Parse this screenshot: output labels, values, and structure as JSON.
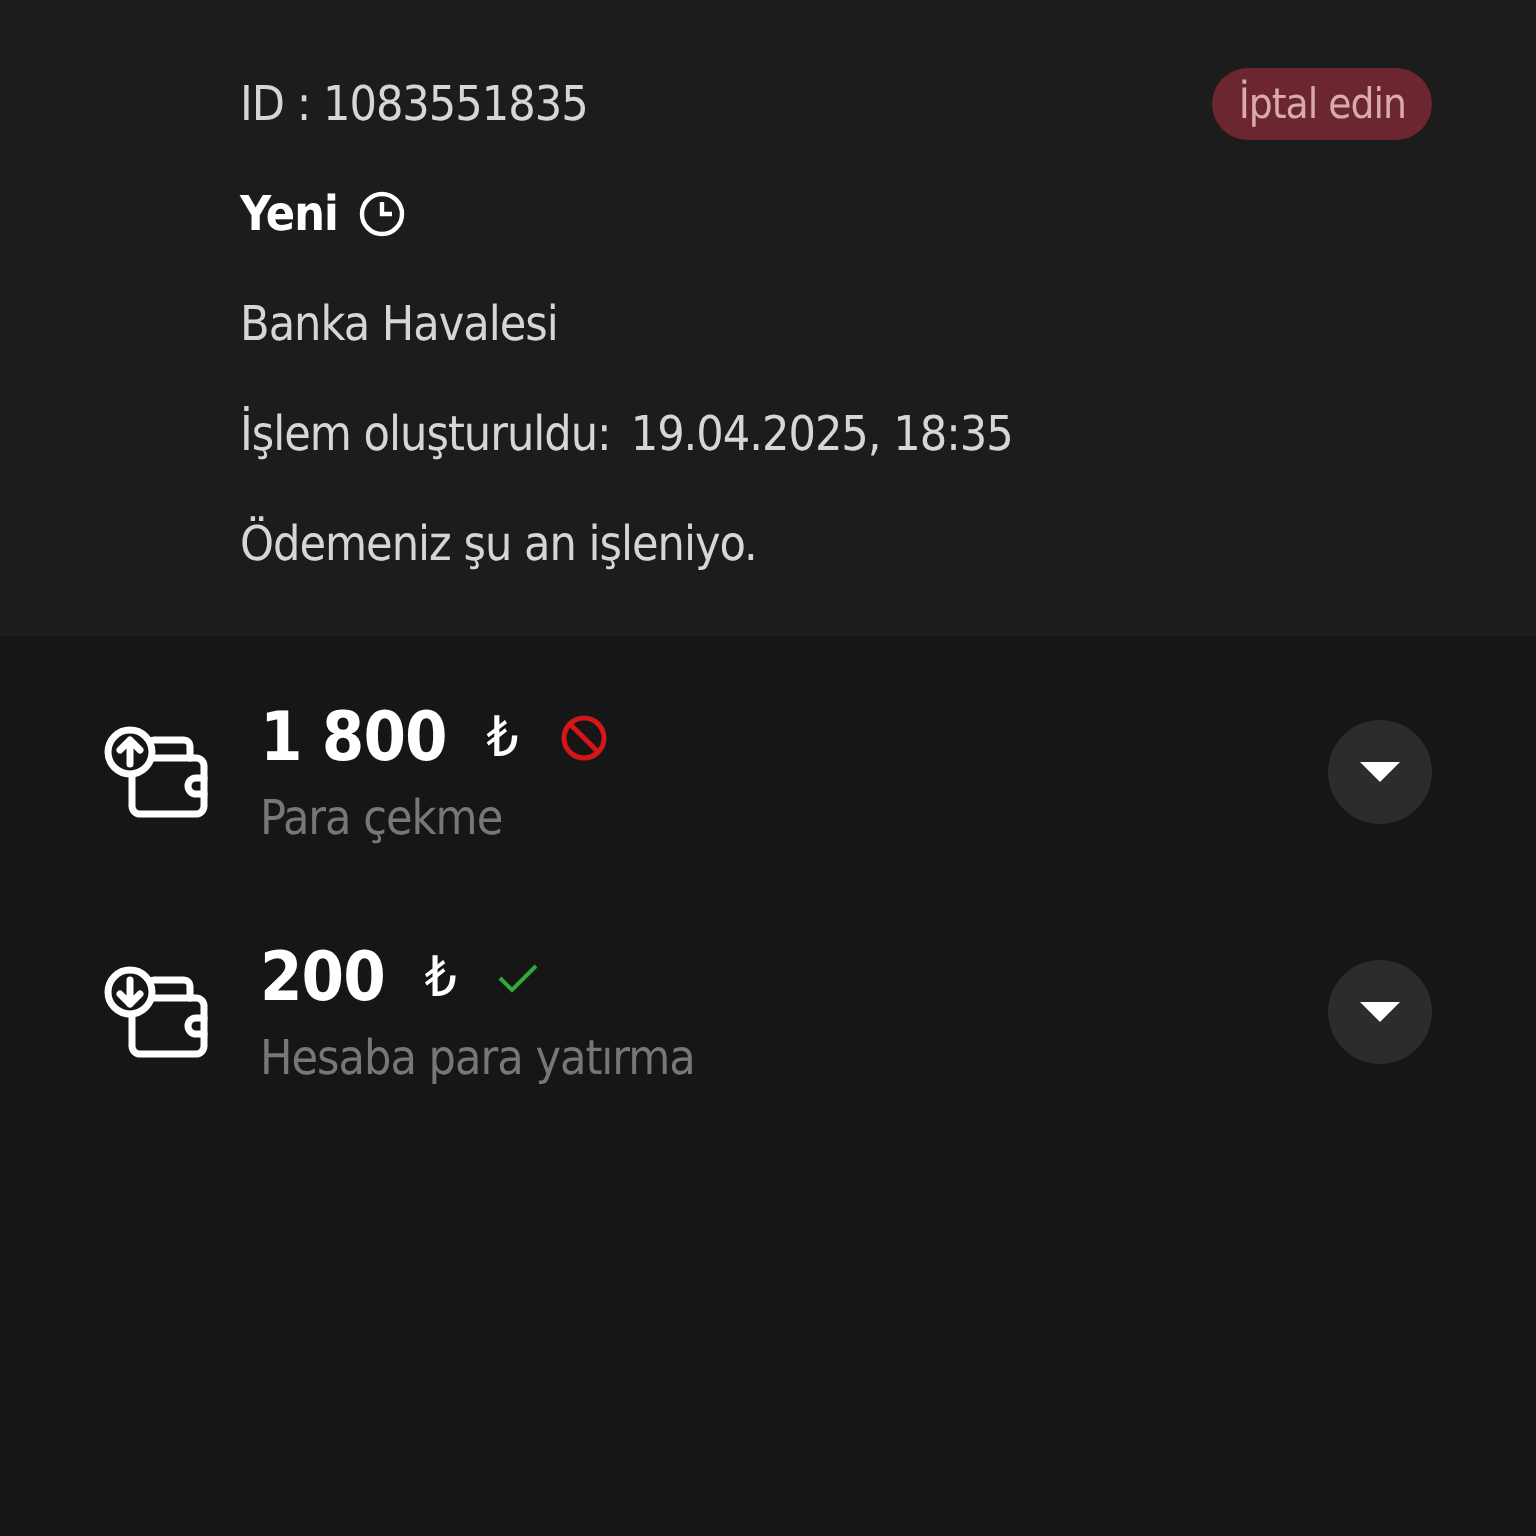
{
  "order": {
    "id_label": "ID : 1083551835",
    "cancel_button": "İptal edin",
    "status": "Yeni",
    "method": "Banka Havalesi",
    "created_label": "İşlem oluşturuldu:",
    "created_value": "19.04.2025, 18:35",
    "message": "Ödemeniz şu an işleniyo."
  },
  "transactions": [
    {
      "kind": "withdrawal",
      "amount": "1 800",
      "currency": "₺",
      "approved": false,
      "label": "Para çekme",
      "expanded": false
    },
    {
      "kind": "deposit",
      "amount": "200",
      "currency": "₺",
      "approved": true,
      "label": "Hesaba para yatırma",
      "expanded": false
    }
  ]
}
